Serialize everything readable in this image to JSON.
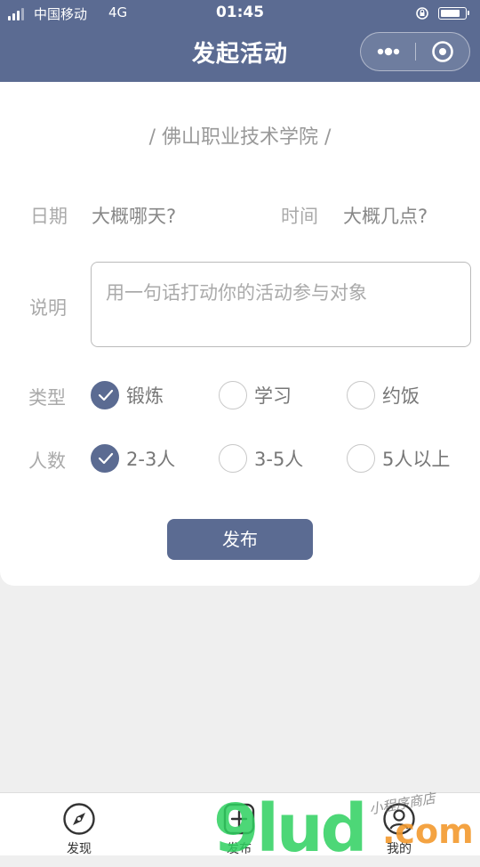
{
  "status_bar": {
    "carrier": "中国移动",
    "network": "4G",
    "time": "01:45",
    "battery_level": 0.85
  },
  "nav": {
    "title": "发起活动"
  },
  "form": {
    "school": "/ 佛山职业技术学院 /",
    "date_label": "日期",
    "date_value": "大概哪天?",
    "time_label": "时间",
    "time_value": "大概几点?",
    "desc_label": "说明",
    "desc_placeholder": "用一句话打动你的活动参与对象",
    "type_label": "类型",
    "type_options": [
      {
        "label": "锻炼",
        "checked": true
      },
      {
        "label": "学习",
        "checked": false
      },
      {
        "label": "约饭",
        "checked": false
      }
    ],
    "count_label": "人数",
    "count_options": [
      {
        "label": "2-3人",
        "checked": true
      },
      {
        "label": "3-5人",
        "checked": false
      },
      {
        "label": "5人以上",
        "checked": false
      }
    ],
    "submit_label": "发布"
  },
  "tabbar": {
    "items": [
      {
        "label": "发现",
        "icon": "compass-icon"
      },
      {
        "label": "发布",
        "icon": "plus-square-icon"
      },
      {
        "label": "我的",
        "icon": "user-icon"
      }
    ]
  },
  "watermark": {
    "main": "9lud",
    "suffix": ".com",
    "script": "小程序商店"
  },
  "colors": {
    "primary": "#5b6b92",
    "background": "#efefef",
    "card": "#ffffff"
  }
}
